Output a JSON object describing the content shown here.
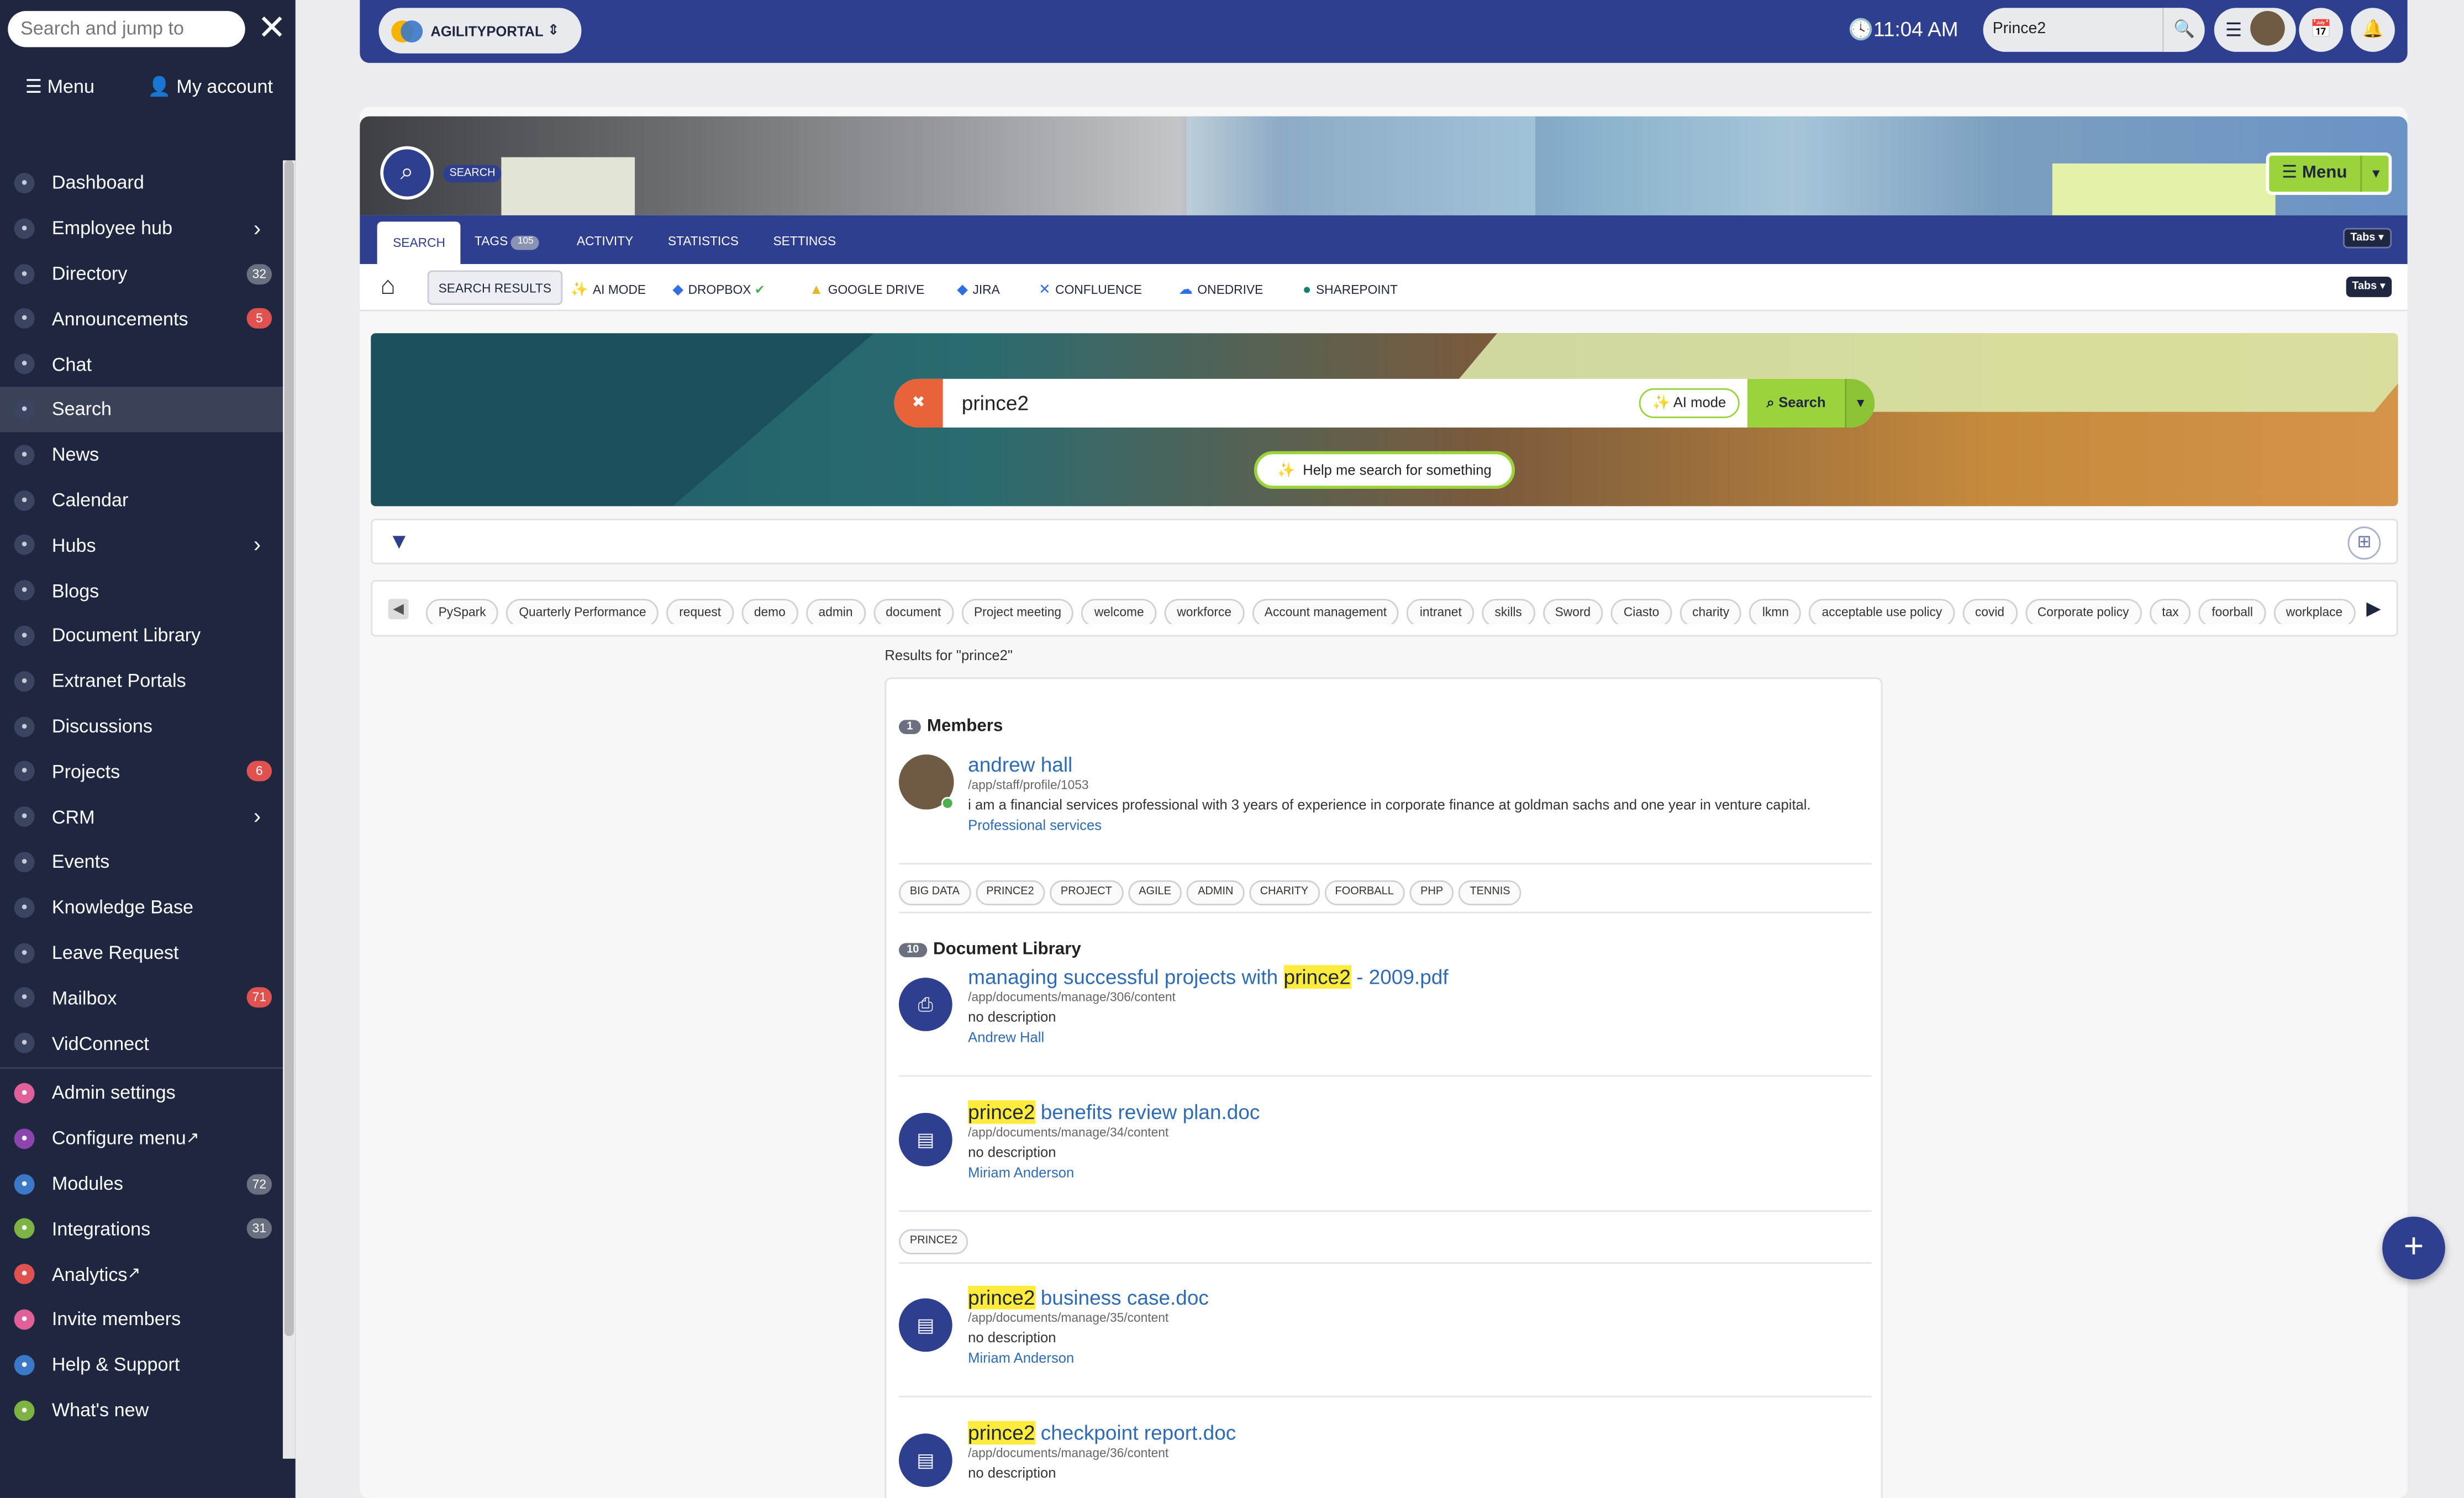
{
  "sidebar": {
    "search_placeholder": "Search and jump to",
    "menu_label": "Menu",
    "account_label": "My account",
    "items": [
      {
        "label": "Dashboard"
      },
      {
        "label": "Employee hub",
        "chevron": true
      },
      {
        "label": "Directory",
        "badge": "32",
        "badge_color": "gray"
      },
      {
        "label": "Announcements",
        "badge": "5",
        "badge_color": "red"
      },
      {
        "label": "Chat"
      },
      {
        "label": "Search",
        "active": true
      },
      {
        "label": "News"
      },
      {
        "label": "Calendar"
      },
      {
        "label": "Hubs",
        "chevron": true
      },
      {
        "label": "Blogs"
      },
      {
        "label": "Document Library"
      },
      {
        "label": "Extranet Portals"
      },
      {
        "label": "Discussions"
      },
      {
        "label": "Projects",
        "badge": "6",
        "badge_color": "red"
      },
      {
        "label": "CRM",
        "chevron": true
      },
      {
        "label": "Events"
      },
      {
        "label": "Knowledge Base"
      },
      {
        "label": "Leave Request"
      },
      {
        "label": "Mailbox",
        "badge": "71",
        "badge_color": "red"
      },
      {
        "label": "VidConnect"
      }
    ],
    "admin_items": [
      {
        "label": "Admin settings",
        "color": "#e0609a"
      },
      {
        "label": "Configure menu",
        "color": "#8e44ad",
        "external": true
      },
      {
        "label": "Modules",
        "badge": "72",
        "badge_color": "gray",
        "color": "#3b78c8"
      },
      {
        "label": "Integrations",
        "badge": "31",
        "badge_color": "gray",
        "color": "#7cb342"
      },
      {
        "label": "Analytics",
        "color": "#e0524f",
        "external": true
      },
      {
        "label": "Invite members",
        "color": "#e0609a"
      },
      {
        "label": "Help & Support",
        "color": "#3b78c8"
      },
      {
        "label": "What's new",
        "color": "#7cb342"
      }
    ]
  },
  "topbar": {
    "brand": "AGILITYPORTAL",
    "time": "11:04 AM",
    "search_value": "Prince2"
  },
  "page": {
    "search_tag": "SEARCH",
    "menu_label": "Menu",
    "tabs": [
      {
        "label": "SEARCH",
        "active": true
      },
      {
        "label": "TAGS",
        "badge": "105"
      },
      {
        "label": "ACTIVITY"
      },
      {
        "label": "STATISTICS"
      },
      {
        "label": "SETTINGS"
      }
    ],
    "tabs_dropdown": "Tabs",
    "subtabs": [
      {
        "label": "SEARCH RESULTS",
        "active": true
      },
      {
        "label": "AI MODE",
        "icon": "sparkle"
      },
      {
        "label": "DROPBOX",
        "icon": "dropbox",
        "verified": true
      },
      {
        "label": "GOOGLE DRIVE",
        "icon": "drive"
      },
      {
        "label": "JIRA",
        "icon": "jira"
      },
      {
        "label": "CONFLUENCE",
        "icon": "confluence"
      },
      {
        "label": "ONEDRIVE",
        "icon": "cloud"
      },
      {
        "label": "SHAREPOINT",
        "icon": "sharepoint"
      }
    ],
    "search_value": "prince2",
    "ai_mode_label": "AI mode",
    "search_button": "Search",
    "help_button": "Help me search for something",
    "tags": [
      "PySpark",
      "Quarterly Performance",
      "request",
      "demo",
      "admin",
      "document",
      "Project meeting",
      "welcome",
      "workforce",
      "Account management",
      "intranet",
      "skills",
      "Sword",
      "Ciasto",
      "charity",
      "lkmn",
      "acceptable use policy",
      "covid",
      "Corporate policy",
      "tax",
      "foorball",
      "workplace"
    ]
  },
  "results": {
    "label": "Results for \"prince2\"",
    "members_count": "1",
    "members_heading": "Members",
    "member": {
      "name": "andrew hall",
      "path": "/app/staff/profile/1053",
      "bio": "i am a financial services professional with 3 years of experience in corporate finance at goldman sachs and one year in venture capital.",
      "department": "Professional services",
      "skills": [
        "BIG DATA",
        "PRINCE2",
        "PROJECT",
        "AGILE",
        "ADMIN",
        "CHARITY",
        "FOORBALL",
        "PHP",
        "TENNIS"
      ]
    },
    "docs_count": "10",
    "docs_heading": "Document Library",
    "docs": [
      {
        "pre": "managing successful projects with ",
        "hl": "prince2",
        "post": " - 2009.pdf",
        "path": "/app/documents/manage/306/content",
        "desc": "no description",
        "author": "Andrew Hall",
        "icon": "pdf"
      },
      {
        "pre": "",
        "hl": "prince2",
        "post": " benefits review plan.doc",
        "path": "/app/documents/manage/34/content",
        "desc": "no description",
        "author": "Miriam Anderson",
        "icon": "doc",
        "tags": [
          "PRINCE2"
        ]
      },
      {
        "pre": "",
        "hl": "prince2",
        "post": " business case.doc",
        "path": "/app/documents/manage/35/content",
        "desc": "no description",
        "author": "Miriam Anderson",
        "icon": "doc"
      },
      {
        "pre": "",
        "hl": "prince2",
        "post": " checkpoint report.doc",
        "path": "/app/documents/manage/36/content",
        "desc": "no description",
        "author": "",
        "icon": "doc"
      }
    ]
  }
}
